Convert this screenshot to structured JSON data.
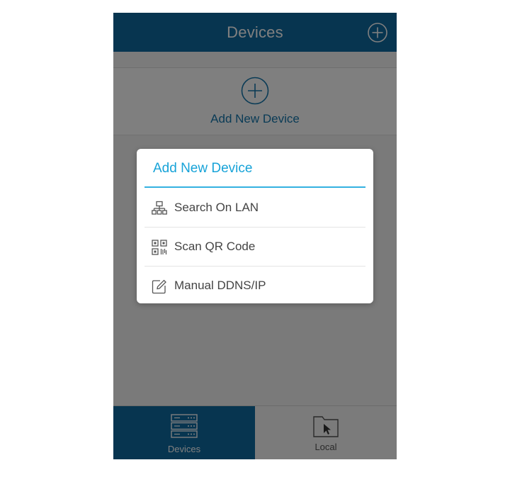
{
  "header": {
    "title": "Devices",
    "add_icon": "plus-circle-icon"
  },
  "add_area": {
    "icon": "plus-circle-icon",
    "label": "Add New Device"
  },
  "dialog": {
    "title": "Add New Device",
    "options": [
      {
        "label": "Search On LAN",
        "icon": "network-icon"
      },
      {
        "label": "Scan QR Code",
        "icon": "qr-code-icon"
      },
      {
        "label": "Manual DDNS/IP",
        "icon": "edit-icon"
      }
    ]
  },
  "tabbar": {
    "tabs": [
      {
        "label": "Devices",
        "icon": "server-rack-icon",
        "active": true
      },
      {
        "label": "Local",
        "icon": "folder-cursor-icon",
        "active": false
      }
    ]
  },
  "colors": {
    "primary": "#0e6aa0",
    "accent": "#17a3d8",
    "overlay": "rgba(0,0,0,0.5)"
  }
}
